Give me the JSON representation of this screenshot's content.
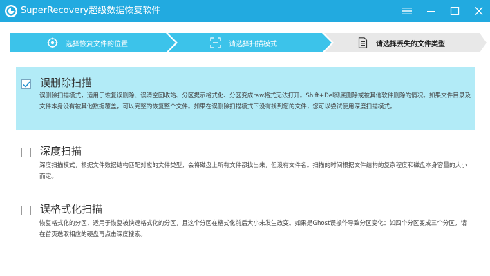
{
  "window": {
    "title": "SuperRecovery超级数据恢复软件",
    "accent_color": "#22aae0",
    "logo_icon": "superrecovery-logo-icon",
    "controls": [
      "menu-icon",
      "minimize-icon",
      "maximize-icon",
      "close-icon"
    ]
  },
  "steps": [
    {
      "label": "选择恢复文件的位置",
      "icon": "location-target-icon",
      "state": "done",
      "color": "#3cc3ea"
    },
    {
      "label": "请选择扫描模式",
      "icon": "scan-frame-icon",
      "state": "current",
      "color": "#3cc3ea"
    },
    {
      "label": "请选择丢失的文件类型",
      "icon": "document-icon",
      "state": "pending",
      "color": "#e8e8e8"
    }
  ],
  "modes": [
    {
      "title": "误删除扫描",
      "checked": true,
      "selected": true,
      "description": "误删除扫描模式，适用于恢复误删除、误清空回收站、分区提示格式化、分区变成raw格式无法打开。Shift+Del彻底删除或被其他软件删除的情况。如果文件目录及文件本身没有被其他数据覆盖，可以完整的恢复整个文件。如果在误删除扫描模式下没有找到您的文件，您可以尝试使用深度扫描模式。"
    },
    {
      "title": "深度扫描",
      "checked": false,
      "selected": false,
      "description": "深度扫描模式，根据文件数据结构匹配对应的文件类型，会将磁盘上所有文件都找出来，但没有文件名。扫描的时间根据文件结构的复杂程度和磁盘本身容量的大小而定。"
    },
    {
      "title": "误格式化扫描",
      "checked": false,
      "selected": false,
      "description": "恢复格式化的分区，适用于恢复被快速格式化的分区，且这个分区在格式化前后大小未发生改变。如果是Ghost误操作导致分区变化：如四个分区变成三个分区，请在首页选取相应的硬盘再点击深度搜索。"
    }
  ]
}
